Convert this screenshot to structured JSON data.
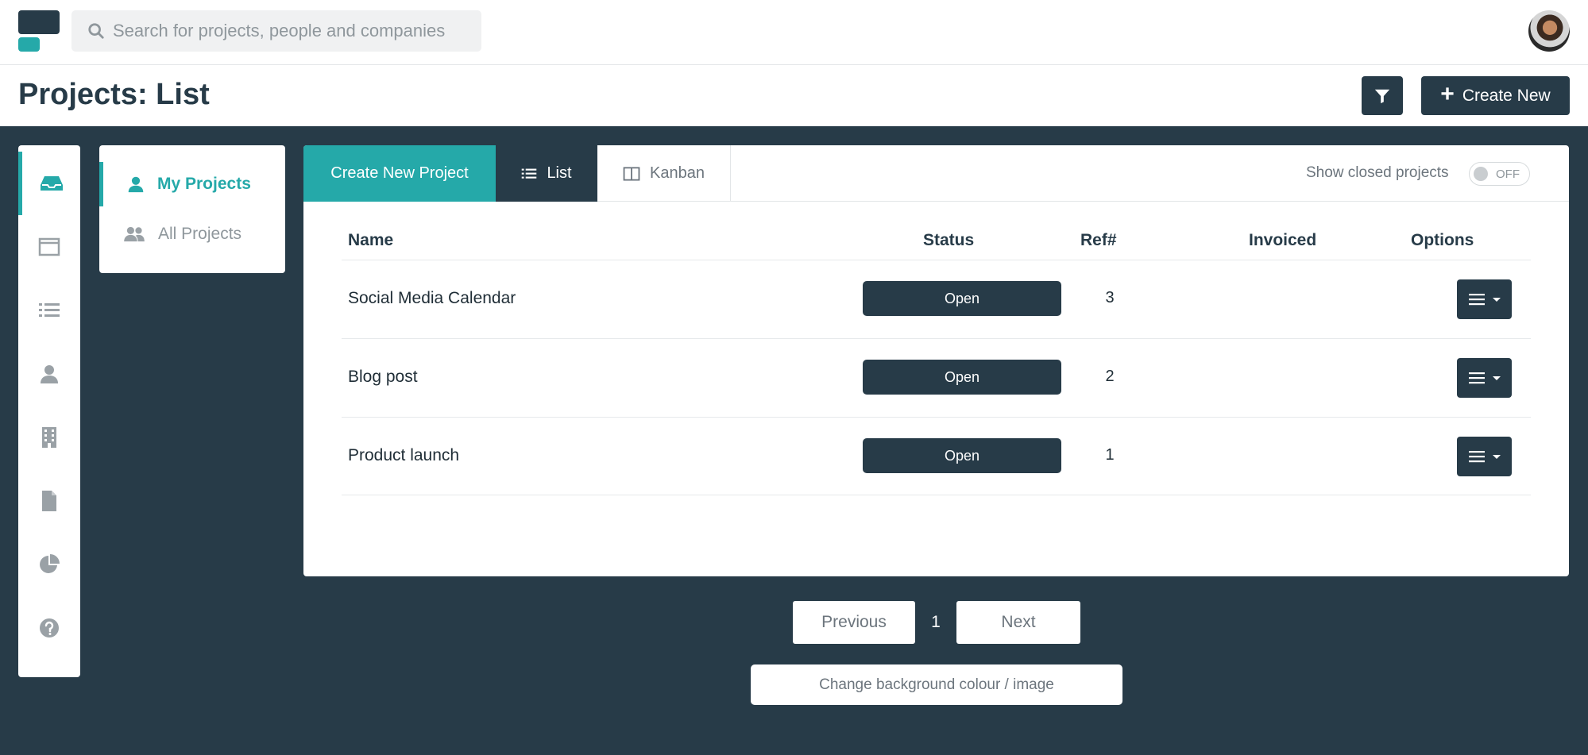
{
  "search": {
    "placeholder": "Search for projects, people and companies"
  },
  "header": {
    "title": "Projects: List",
    "create_label": "Create New"
  },
  "rail": {
    "items": [
      "inbox-icon",
      "browser-window-icon",
      "list-icon",
      "user-icon",
      "building-icon",
      "document-icon",
      "pie-chart-icon",
      "help-icon"
    ]
  },
  "projects_nav": {
    "items": [
      {
        "label": "My Projects",
        "active": true
      },
      {
        "label": "All Projects",
        "active": false
      }
    ]
  },
  "tabs": {
    "create": "Create New Project",
    "list": "List",
    "kanban": "Kanban"
  },
  "show_closed": {
    "label": "Show closed projects",
    "state": "OFF"
  },
  "table": {
    "headers": {
      "name": "Name",
      "status": "Status",
      "ref": "Ref#",
      "invoiced": "Invoiced",
      "options": "Options"
    },
    "rows": [
      {
        "name": "Social Media Calendar",
        "status": "Open",
        "ref": "3",
        "invoiced": ""
      },
      {
        "name": "Blog post",
        "status": "Open",
        "ref": "2",
        "invoiced": ""
      },
      {
        "name": "Product launch",
        "status": "Open",
        "ref": "1",
        "invoiced": ""
      }
    ]
  },
  "pagination": {
    "previous": "Previous",
    "page": "1",
    "next": "Next"
  },
  "background_button": "Change background colour / image",
  "colors": {
    "accent": "#25a9a9",
    "dark": "#273b48"
  }
}
